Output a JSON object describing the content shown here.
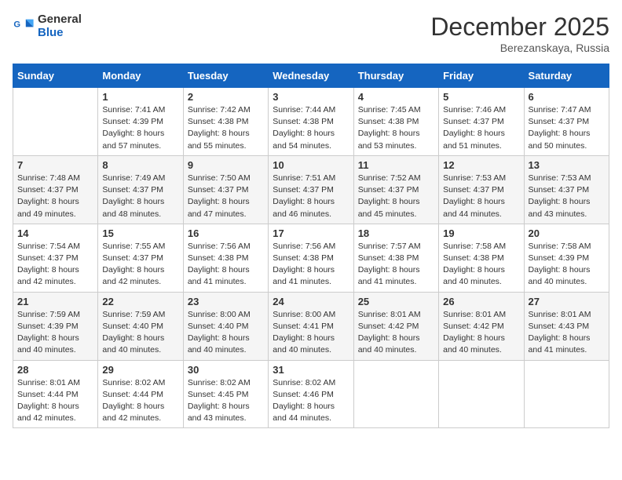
{
  "header": {
    "logo_line1": "General",
    "logo_line2": "Blue",
    "month_year": "December 2025",
    "location": "Berezanskaya, Russia"
  },
  "weekdays": [
    "Sunday",
    "Monday",
    "Tuesday",
    "Wednesday",
    "Thursday",
    "Friday",
    "Saturday"
  ],
  "weeks": [
    [
      {
        "day": "",
        "info": ""
      },
      {
        "day": "1",
        "info": "Sunrise: 7:41 AM\nSunset: 4:39 PM\nDaylight: 8 hours\nand 57 minutes."
      },
      {
        "day": "2",
        "info": "Sunrise: 7:42 AM\nSunset: 4:38 PM\nDaylight: 8 hours\nand 55 minutes."
      },
      {
        "day": "3",
        "info": "Sunrise: 7:44 AM\nSunset: 4:38 PM\nDaylight: 8 hours\nand 54 minutes."
      },
      {
        "day": "4",
        "info": "Sunrise: 7:45 AM\nSunset: 4:38 PM\nDaylight: 8 hours\nand 53 minutes."
      },
      {
        "day": "5",
        "info": "Sunrise: 7:46 AM\nSunset: 4:37 PM\nDaylight: 8 hours\nand 51 minutes."
      },
      {
        "day": "6",
        "info": "Sunrise: 7:47 AM\nSunset: 4:37 PM\nDaylight: 8 hours\nand 50 minutes."
      }
    ],
    [
      {
        "day": "7",
        "info": "Sunrise: 7:48 AM\nSunset: 4:37 PM\nDaylight: 8 hours\nand 49 minutes."
      },
      {
        "day": "8",
        "info": "Sunrise: 7:49 AM\nSunset: 4:37 PM\nDaylight: 8 hours\nand 48 minutes."
      },
      {
        "day": "9",
        "info": "Sunrise: 7:50 AM\nSunset: 4:37 PM\nDaylight: 8 hours\nand 47 minutes."
      },
      {
        "day": "10",
        "info": "Sunrise: 7:51 AM\nSunset: 4:37 PM\nDaylight: 8 hours\nand 46 minutes."
      },
      {
        "day": "11",
        "info": "Sunrise: 7:52 AM\nSunset: 4:37 PM\nDaylight: 8 hours\nand 45 minutes."
      },
      {
        "day": "12",
        "info": "Sunrise: 7:53 AM\nSunset: 4:37 PM\nDaylight: 8 hours\nand 44 minutes."
      },
      {
        "day": "13",
        "info": "Sunrise: 7:53 AM\nSunset: 4:37 PM\nDaylight: 8 hours\nand 43 minutes."
      }
    ],
    [
      {
        "day": "14",
        "info": "Sunrise: 7:54 AM\nSunset: 4:37 PM\nDaylight: 8 hours\nand 42 minutes."
      },
      {
        "day": "15",
        "info": "Sunrise: 7:55 AM\nSunset: 4:37 PM\nDaylight: 8 hours\nand 42 minutes."
      },
      {
        "day": "16",
        "info": "Sunrise: 7:56 AM\nSunset: 4:38 PM\nDaylight: 8 hours\nand 41 minutes."
      },
      {
        "day": "17",
        "info": "Sunrise: 7:56 AM\nSunset: 4:38 PM\nDaylight: 8 hours\nand 41 minutes."
      },
      {
        "day": "18",
        "info": "Sunrise: 7:57 AM\nSunset: 4:38 PM\nDaylight: 8 hours\nand 41 minutes."
      },
      {
        "day": "19",
        "info": "Sunrise: 7:58 AM\nSunset: 4:38 PM\nDaylight: 8 hours\nand 40 minutes."
      },
      {
        "day": "20",
        "info": "Sunrise: 7:58 AM\nSunset: 4:39 PM\nDaylight: 8 hours\nand 40 minutes."
      }
    ],
    [
      {
        "day": "21",
        "info": "Sunrise: 7:59 AM\nSunset: 4:39 PM\nDaylight: 8 hours\nand 40 minutes."
      },
      {
        "day": "22",
        "info": "Sunrise: 7:59 AM\nSunset: 4:40 PM\nDaylight: 8 hours\nand 40 minutes."
      },
      {
        "day": "23",
        "info": "Sunrise: 8:00 AM\nSunset: 4:40 PM\nDaylight: 8 hours\nand 40 minutes."
      },
      {
        "day": "24",
        "info": "Sunrise: 8:00 AM\nSunset: 4:41 PM\nDaylight: 8 hours\nand 40 minutes."
      },
      {
        "day": "25",
        "info": "Sunrise: 8:01 AM\nSunset: 4:42 PM\nDaylight: 8 hours\nand 40 minutes."
      },
      {
        "day": "26",
        "info": "Sunrise: 8:01 AM\nSunset: 4:42 PM\nDaylight: 8 hours\nand 40 minutes."
      },
      {
        "day": "27",
        "info": "Sunrise: 8:01 AM\nSunset: 4:43 PM\nDaylight: 8 hours\nand 41 minutes."
      }
    ],
    [
      {
        "day": "28",
        "info": "Sunrise: 8:01 AM\nSunset: 4:44 PM\nDaylight: 8 hours\nand 42 minutes."
      },
      {
        "day": "29",
        "info": "Sunrise: 8:02 AM\nSunset: 4:44 PM\nDaylight: 8 hours\nand 42 minutes."
      },
      {
        "day": "30",
        "info": "Sunrise: 8:02 AM\nSunset: 4:45 PM\nDaylight: 8 hours\nand 43 minutes."
      },
      {
        "day": "31",
        "info": "Sunrise: 8:02 AM\nSunset: 4:46 PM\nDaylight: 8 hours\nand 44 minutes."
      },
      {
        "day": "",
        "info": ""
      },
      {
        "day": "",
        "info": ""
      },
      {
        "day": "",
        "info": ""
      }
    ]
  ]
}
